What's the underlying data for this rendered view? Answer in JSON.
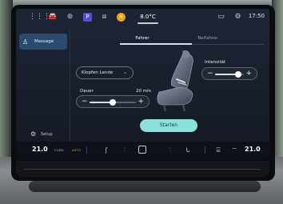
{
  "statusbar": {
    "interior_temp": "8.0°C",
    "clock": "17:50",
    "icons": [
      "apps-grid-icon",
      "car-icon",
      "steering-icon",
      "p-badge-icon",
      "seat-heat-icon",
      "sun-badge-icon",
      "message-icon",
      "settings-icon"
    ]
  },
  "menu": {
    "massage_label": "Massage",
    "setup_label": "Setup"
  },
  "tabs": [
    {
      "label": "Fahrer",
      "active": true
    },
    {
      "label": "Beifahrer",
      "active": false
    }
  ],
  "program": {
    "selected": "Klopfen Lende"
  },
  "duration": {
    "label": "Dauer",
    "value_text": "20 min",
    "level": 0.5
  },
  "intensity": {
    "label": "Intensität",
    "level": 0.8
  },
  "start_button": "Starten",
  "bottombar": {
    "left_temp": "21.0",
    "left_climate_label": "CLIMA",
    "left_auto_label": "AUTO",
    "right_temp": "21.0"
  },
  "colors": {
    "accent": "#8be0dc",
    "active_menu": "#2a4a6e",
    "alert_red": "#e03a3a"
  }
}
